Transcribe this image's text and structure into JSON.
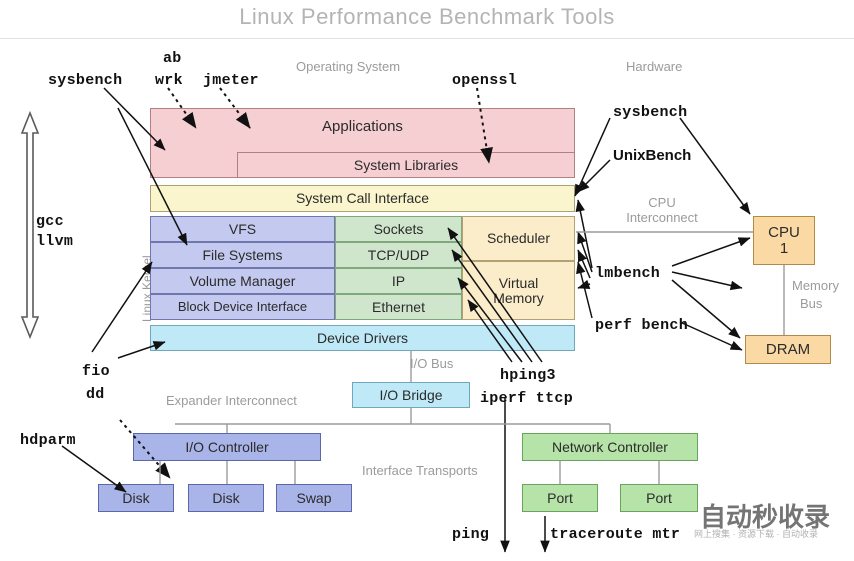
{
  "title": "Linux Performance Benchmark Tools",
  "section_labels": {
    "operating_system": "Operating System",
    "hardware": "Hardware",
    "linux_kernel": "Linux Kernel",
    "cpu_interconnect_line1": "CPU",
    "cpu_interconnect_line2": "Interconnect",
    "memory_bus_line1": "Memory",
    "memory_bus_line2": "Bus",
    "io_bus": "I/O Bus",
    "expander_interconnect": "Expander Interconnect",
    "interface_transports": "Interface Transports"
  },
  "os_stack": {
    "applications": "Applications",
    "system_libraries": "System Libraries",
    "system_call_interface": "System Call Interface",
    "device_drivers": "Device Drivers",
    "left_column": [
      "VFS",
      "File Systems",
      "Volume Manager",
      "Block Device Interface"
    ],
    "middle_column": [
      "Sockets",
      "TCP/UDP",
      "IP",
      "Ethernet"
    ],
    "right_column": [
      "Scheduler",
      "Virtual\nMemory"
    ],
    "scheduler": "Scheduler",
    "virtual_memory_line1": "Virtual",
    "virtual_memory_line2": "Memory"
  },
  "hardware": {
    "cpu_line1": "CPU",
    "cpu_line2": "1",
    "dram": "DRAM"
  },
  "io_subsystem": {
    "io_bridge": "I/O Bridge",
    "io_controller": "I/O Controller",
    "disk1": "Disk",
    "disk2": "Disk",
    "swap": "Swap"
  },
  "network_subsystem": {
    "network_controller": "Network Controller",
    "port1": "Port",
    "port2": "Port"
  },
  "tools": {
    "sysbench_top": "sysbench",
    "ab": "ab",
    "wrk": "wrk",
    "jmeter": "jmeter",
    "openssl": "openssl",
    "sysbench_right": "sysbench",
    "unixbench": "UnixBench",
    "lmbench": "lmbench",
    "perf_bench": "perf bench",
    "gcc": "gcc",
    "llvm": "llvm",
    "fio": "fio",
    "dd": "dd",
    "hdparm": "hdparm",
    "hping3": "hping3",
    "iperf_ttcp": "iperf ttcp",
    "ping": "ping",
    "traceroute_mtr": "traceroute mtr"
  },
  "watermark": {
    "text": "自动秒收录",
    "sub": "网上搜集 · 资源下载 · 自动收录"
  },
  "colors": {
    "applications": "#f6cfd2",
    "syscall": "#faf5cd",
    "filesystem": "#c3c9ef",
    "network": "#cfe6cd",
    "scheduler": "#fbecca",
    "device_drivers": "#bfe9f7",
    "hardware_box": "#fbd9a5",
    "io_box": "#a9b4e8",
    "net_box": "#b5e3a8",
    "io_bridge": "#bfe9f7",
    "title_text": "#b4b4b4",
    "annotation_text": "#9b9b9b"
  }
}
